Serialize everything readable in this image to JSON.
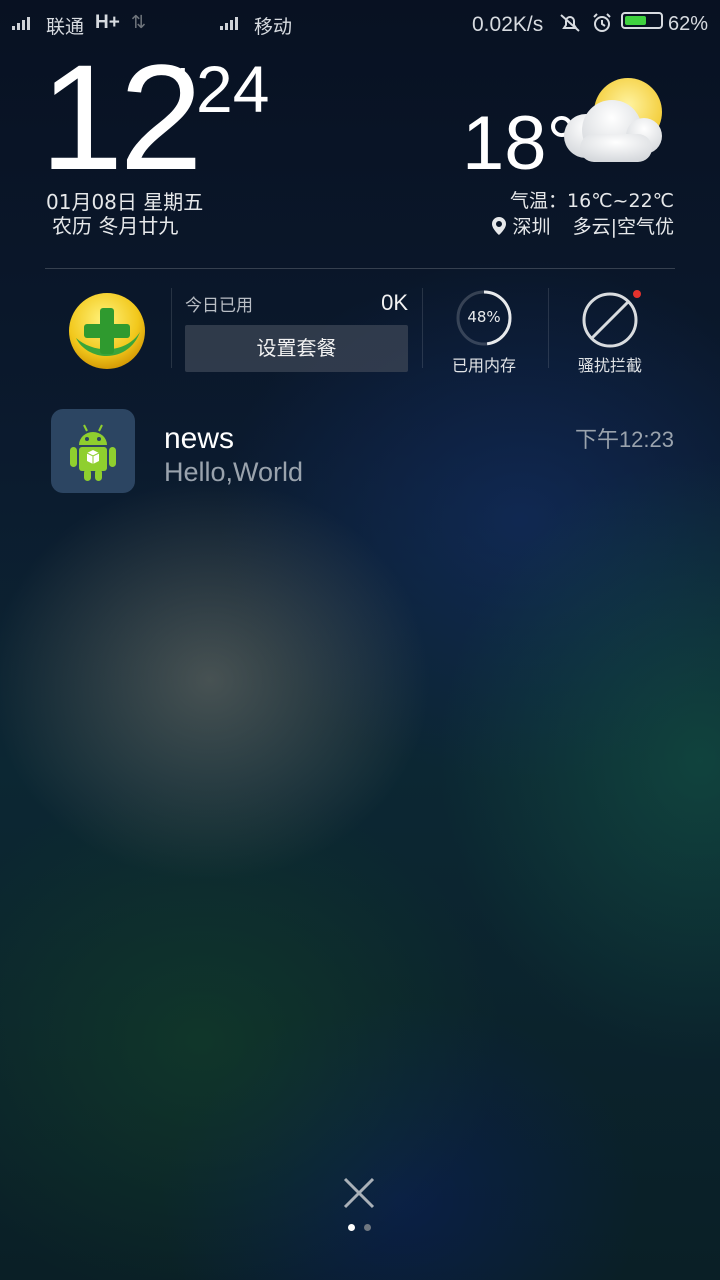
{
  "status_bar": {
    "carrier1": "联通",
    "network1": "H+",
    "carrier2": "移动",
    "speed": "0.02K/s",
    "battery": "62%",
    "battery_level": 0.62,
    "battery_color": "#3fd13f"
  },
  "clock": {
    "hour": "12",
    "minute": "24"
  },
  "date": {
    "line1": "01月08日 星期五",
    "line2": "农历 冬月廿九"
  },
  "weather": {
    "temp": "18°",
    "range": "气温：16℃~22℃",
    "location": "深圳",
    "condition": "多云|空气优",
    "icon": "partly-cloudy-icon"
  },
  "widgets": {
    "data_label": "今日已用",
    "data_value": "0K",
    "plan_button": "设置套餐",
    "memory_percent": "48%",
    "memory_value": 48,
    "memory_label": "已用内存",
    "block_label": "骚扰拦截"
  },
  "notification": {
    "app_icon": "android-icon",
    "title": "news",
    "body": "Hello,World",
    "time": "下午12:23"
  },
  "pager": {
    "pages": 2,
    "active": 0
  }
}
